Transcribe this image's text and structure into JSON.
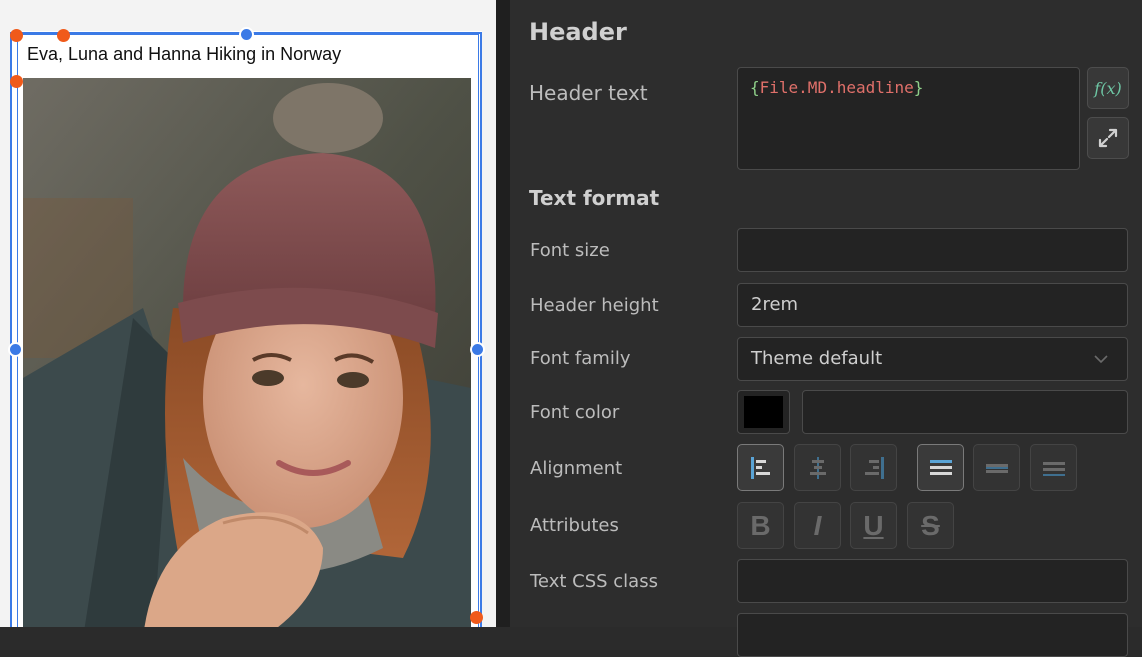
{
  "canvas": {
    "card_title": "Eva, Luna and Hanna Hiking in Norway",
    "selection_color": "#3b7ae6",
    "handle_color": "#f05a1a"
  },
  "panel": {
    "title": "Header",
    "header_text": {
      "label": "Header text",
      "open_brace": "{",
      "expression": "File.MD.headline",
      "close_brace": "}",
      "fx_label": "f(x)",
      "expression_color": "#e0706a",
      "brace_color": "#8fd08a"
    },
    "text_format": {
      "section_title": "Text format",
      "font_size": {
        "label": "Font size",
        "value": ""
      },
      "header_height": {
        "label": "Header height",
        "value": "2rem"
      },
      "font_family": {
        "label": "Font family",
        "value": "Theme default"
      },
      "font_color": {
        "label": "Font color",
        "swatch": "#000000",
        "value": ""
      },
      "alignment": {
        "label": "Alignment",
        "horizontal": [
          "align-left",
          "align-center",
          "align-right"
        ],
        "vertical": [
          "align-top",
          "align-middle",
          "align-bottom"
        ],
        "active": [
          "align-left",
          "align-top"
        ]
      },
      "attributes": {
        "label": "Attributes",
        "bold": "B",
        "italic": "I",
        "underline": "U",
        "strike": "S"
      },
      "css_class": {
        "label": "Text CSS class",
        "value": ""
      }
    }
  }
}
